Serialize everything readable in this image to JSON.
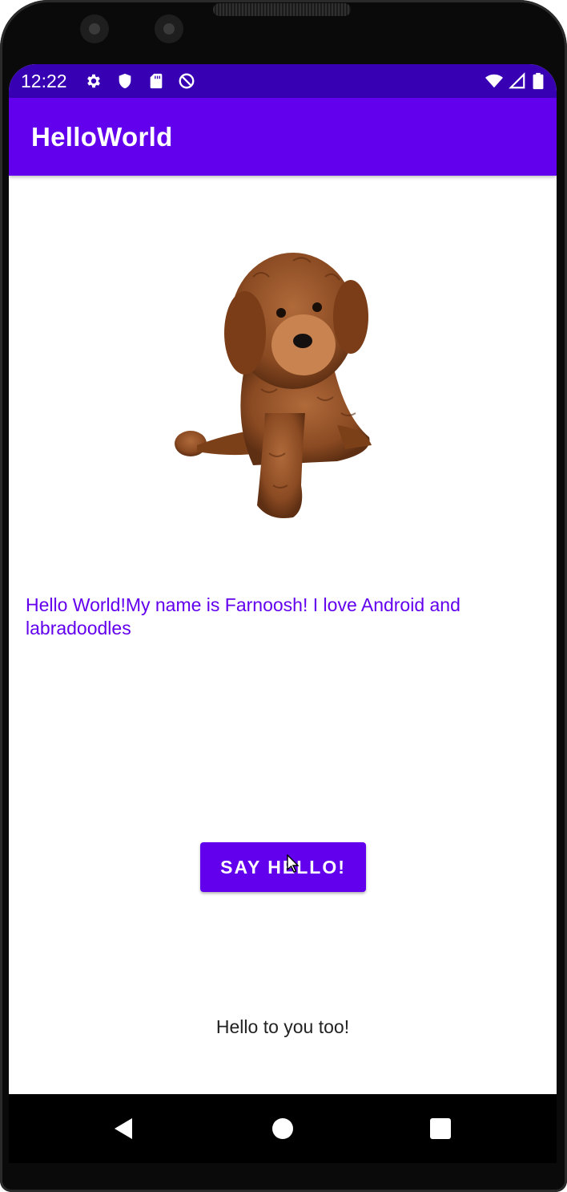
{
  "status_bar": {
    "time": "12:22",
    "left_icons": [
      "gear-icon",
      "shield-icon",
      "sd-card-icon",
      "sync-disabled-icon"
    ],
    "right_icons": [
      "wifi-icon",
      "cellular-signal-icon",
      "battery-icon"
    ]
  },
  "app_bar": {
    "title": "HelloWorld"
  },
  "main": {
    "image": {
      "subject": "labradoodle-dog-photo"
    },
    "intro_text": "Hello World!My name is Farnoosh! I love Android and labradoodles",
    "button_label": "SAY HELLO!",
    "reply_text": "Hello to you too!"
  },
  "nav_bar": {
    "buttons": [
      "back-icon",
      "home-icon",
      "recents-icon"
    ]
  },
  "colors": {
    "status_bar": "#3700b3",
    "app_bar": "#6200ee",
    "accent_text": "#6200ee",
    "button": "#6200ee"
  }
}
